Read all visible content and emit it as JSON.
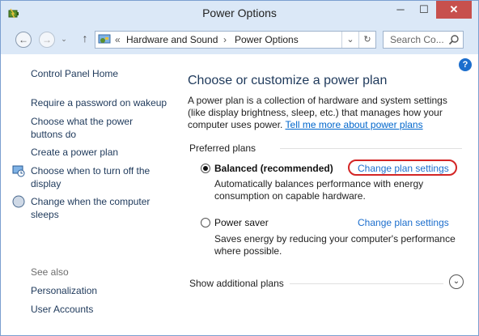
{
  "window": {
    "title": "Power Options",
    "minimize": "─",
    "maximize": "☐",
    "close": "✕"
  },
  "nav": {
    "back": "←",
    "forward": "→",
    "up": "↑",
    "chevron": "«",
    "breadcrumbs": [
      "Hardware and Sound",
      "Power Options"
    ],
    "crumb_sep": "›",
    "dropdown": "⌄",
    "refresh": "↻",
    "search_placeholder": "Search Co..."
  },
  "sidebar": {
    "home": "Control Panel Home",
    "items": [
      "Require a password on wakeup",
      "Choose what the power buttons do",
      "Create a power plan",
      "Choose when to turn off the display",
      "Change when the computer sleeps"
    ],
    "see_also_label": "See also",
    "see_also": [
      "Personalization",
      "User Accounts"
    ]
  },
  "main": {
    "help": "?",
    "title": "Choose or customize a power plan",
    "description": "A power plan is a collection of hardware and system settings (like display brightness, sleep, etc.) that manages how your computer uses power. ",
    "description_link": "Tell me more about power plans",
    "preferred_label": "Preferred plans",
    "plans": [
      {
        "name": "Balanced (recommended)",
        "selected": true,
        "link": "Change plan settings",
        "desc": "Automatically balances performance with energy consumption on capable hardware."
      },
      {
        "name": "Power saver",
        "selected": false,
        "link": "Change plan settings",
        "desc": "Saves energy by reducing your computer's performance where possible."
      }
    ],
    "show_more": "Show additional plans",
    "expand": "⌄"
  },
  "colors": {
    "accent": "#1c6ecd",
    "highlight": "#d32525",
    "title_text": "#1e395b"
  }
}
